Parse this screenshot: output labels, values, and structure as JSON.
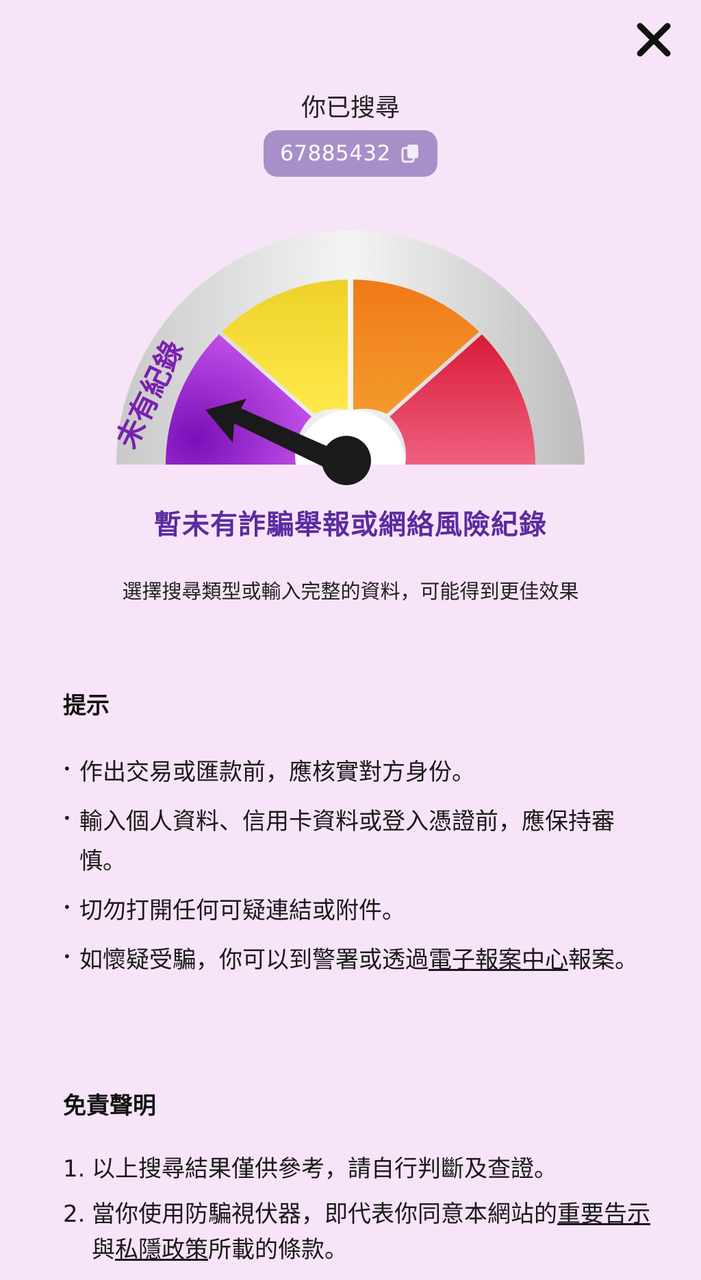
{
  "header": {
    "close_icon": "close-icon",
    "searched_label": "你已搜尋",
    "search_value": "67885432",
    "copy_icon": "copy-icon"
  },
  "gauge": {
    "label": "未有紀錄",
    "level": "未有紀錄",
    "segment_colors": [
      "#9a1fd0",
      "#f2e03a",
      "#f59a2a",
      "#e23050"
    ],
    "needle_color": "#1a1a1a"
  },
  "result": {
    "status_title": "暫未有詐騙舉報或網絡風險紀錄",
    "hint": "選擇搜尋類型或輸入完整的資料，可能得到更佳效果"
  },
  "tips": {
    "heading": "提示",
    "items": [
      {
        "text": "作出交易或匯款前，應核實對方身份。"
      },
      {
        "text": "輸入個人資料、信用卡資料或登入憑證前，應保持審慎。"
      },
      {
        "text": "切勿打開任何可疑連結或附件。"
      },
      {
        "before": "如懷疑受騙，你可以到警署或透過",
        "link": "電子報案中心",
        "after": "報案。"
      }
    ]
  },
  "disclaimer": {
    "heading": "免責聲明",
    "items": [
      {
        "num": "1.",
        "text": "以上搜尋結果僅供參考，請自行判斷及查證。"
      },
      {
        "num": "2.",
        "before": "當你使用防騙視伏器，即代表你同意本網站的",
        "link1": "重要告示",
        "mid": "與",
        "link2": "私隱政策",
        "after": "所載的條款。"
      }
    ]
  }
}
